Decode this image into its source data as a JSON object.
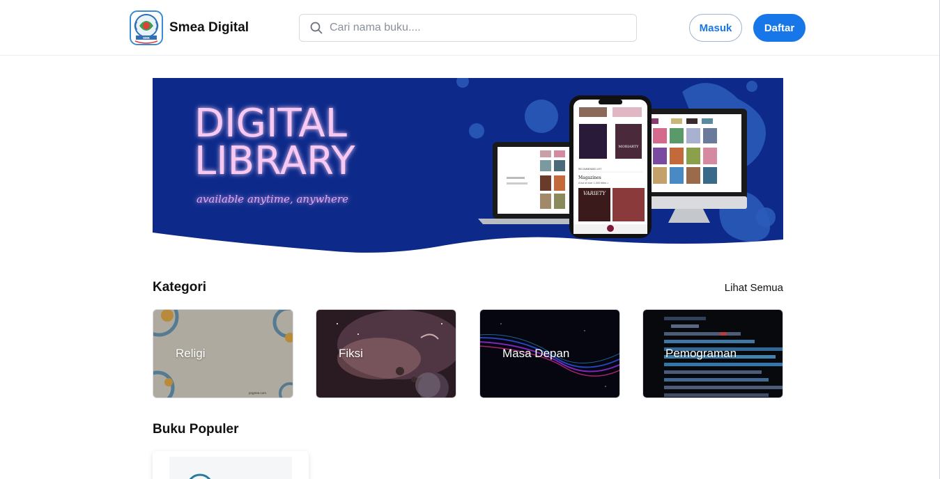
{
  "brand": {
    "name": "Smea Digital",
    "logo_text": "SMK"
  },
  "search": {
    "placeholder": "Cari nama buku...."
  },
  "nav": {
    "login_label": "Masuk",
    "register_label": "Daftar"
  },
  "banner": {
    "title_line1": "DIGITAL",
    "title_line2": "LIBRARY",
    "tagline": "available anytime, anywhere",
    "phone_section_label": "Magazines",
    "phone_section_sub": "A list of over 1,000 titles >",
    "phone_header_small": "RECOMMENDED LIST",
    "magazine_title": "VARIETY",
    "book_title": "MORIARTY"
  },
  "categories": {
    "title": "Kategori",
    "see_all": "Lihat Semua",
    "items": [
      {
        "label": "Religi",
        "watermark": "pngtree.com"
      },
      {
        "label": "Fiksi"
      },
      {
        "label": "Masa Depan"
      },
      {
        "label": "Pemograman"
      }
    ]
  },
  "popular": {
    "title": "Buku Populer"
  },
  "colors": {
    "accent": "#1877e8",
    "banner_bg": "#0d2a8a",
    "neon": "#f6c8f2"
  },
  "icons": [
    "search-icon",
    "school-logo"
  ]
}
